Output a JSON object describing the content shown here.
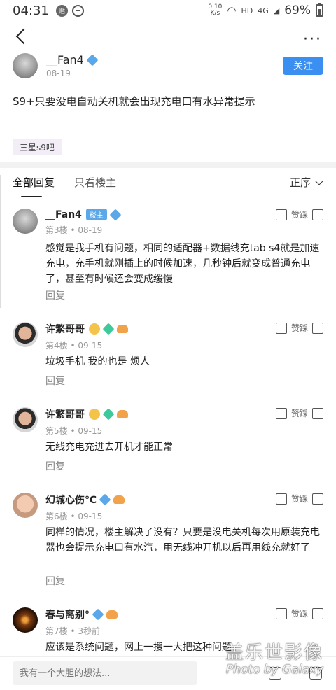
{
  "status": {
    "time": "04:31",
    "net_speed_value": "0.10",
    "net_speed_unit": "K/s",
    "network": "HD",
    "signal": "4G",
    "battery": "69%"
  },
  "topbar": {
    "back_icon": "back-icon",
    "more_icon": "more-icon"
  },
  "post": {
    "author": "__Fan4",
    "date": "08-19",
    "follow_label": "关注",
    "text": "S9+只要没电自动关机就会出现充电口有水异常提示",
    "tag": "三星s9吧"
  },
  "tabs": {
    "all": "全部回复",
    "owner_only": "只看楼主",
    "sort": "正序"
  },
  "comments": [
    {
      "name": "__Fan4",
      "badge": "楼主",
      "floor": "第3楼",
      "date": "08-19",
      "text": "感觉是我手机有问题，相同的适配器+数据线充tab s4就是加速充电，充手机就刚插上的时候加速，几秒钟后就变成普通充电了，甚至有时候还会变成缓慢",
      "reply": "回复",
      "vote": "赞踩"
    },
    {
      "name": "许繁哥哥",
      "floor": "第4楼",
      "date": "09-15",
      "text": "垃圾手机 我的也是 烦人",
      "reply": "回复",
      "vote": "赞踩"
    },
    {
      "name": "许繁哥哥",
      "floor": "第5楼",
      "date": "09-15",
      "text": "无线充电充进去开机才能正常",
      "reply": "回复",
      "vote": "赞踩"
    },
    {
      "name": "幻城心伤℃",
      "floor": "第6楼",
      "date": "09-15",
      "text": "同样的情况，楼主解决了没有？只要是没电关机每次用原装充电器也会提示充电口有水汽，用无线冲开机以后再用线充就好了",
      "reply": "回复",
      "vote": "赞踩"
    },
    {
      "name": "春与离别°",
      "floor": "第7楼",
      "date": "3秒前",
      "text": "应该是系统问题，网上一搜一大把这种问题",
      "vote": "赞踩"
    }
  ],
  "bottom": {
    "placeholder": "我有一个大胆的想法..."
  },
  "watermark": {
    "line1": "盖乐世影像",
    "line2": "Photo by Galaxy"
  }
}
